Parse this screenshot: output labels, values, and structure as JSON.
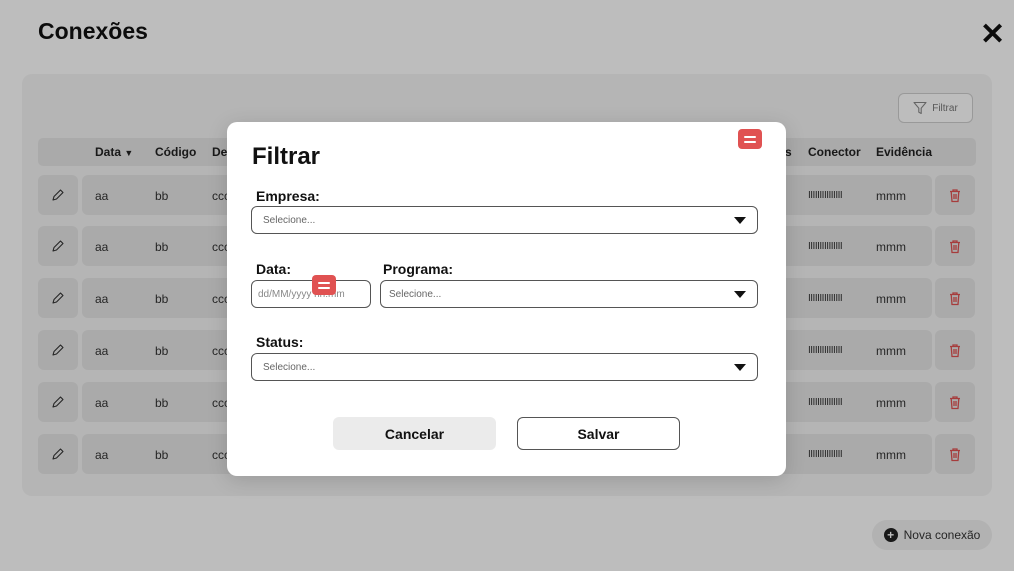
{
  "page": {
    "title": "Conexões"
  },
  "toolbar": {
    "filter_label": "Filtrar",
    "new_connection_label": "Nova conexão"
  },
  "table": {
    "headers": [
      "Data",
      "Código",
      "De",
      "s",
      "Conector",
      "Evidência"
    ],
    "rows": [
      {
        "data": "aa",
        "codigo": "bb",
        "de": "ccc",
        "conector": "IIIIIIIIIIIIIII",
        "evidencia": "mmm"
      },
      {
        "data": "aa",
        "codigo": "bb",
        "de": "ccc",
        "conector": "IIIIIIIIIIIIIII",
        "evidencia": "mmm"
      },
      {
        "data": "aa",
        "codigo": "bb",
        "de": "ccc",
        "conector": "IIIIIIIIIIIIIII",
        "evidencia": "mmm"
      },
      {
        "data": "aa",
        "codigo": "bb",
        "de": "ccc",
        "conector": "IIIIIIIIIIIIIII",
        "evidencia": "mmm"
      },
      {
        "data": "aa",
        "codigo": "bb",
        "de": "ccc",
        "conector": "IIIIIIIIIIIIIII",
        "evidencia": "mmm"
      },
      {
        "data": "aa",
        "codigo": "bb",
        "de": "ccc",
        "conector": "IIIIIIIIIIIIIII",
        "evidencia": "mmm"
      }
    ]
  },
  "modal": {
    "title": "Filtrar",
    "empresa_label": "Empresa:",
    "empresa_placeholder": "Selecione...",
    "data_label": "Data:",
    "data_placeholder": "dd/MM/yyyy hh:mm",
    "programa_label": "Programa:",
    "programa_placeholder": "Selecione...",
    "status_label": "Status:",
    "status_placeholder": "Selecione...",
    "cancel_label": "Cancelar",
    "save_label": "Salvar"
  },
  "icons": {
    "close": "close-icon",
    "filter": "filter-icon",
    "edit": "pencil-icon",
    "delete": "trash-icon",
    "add": "plus-circle-icon",
    "comment": "comment-icon",
    "dropdown": "caret-down-icon"
  },
  "colors": {
    "accent_red": "#e05252",
    "overlay": "rgba(0,0,0,0.26)"
  }
}
